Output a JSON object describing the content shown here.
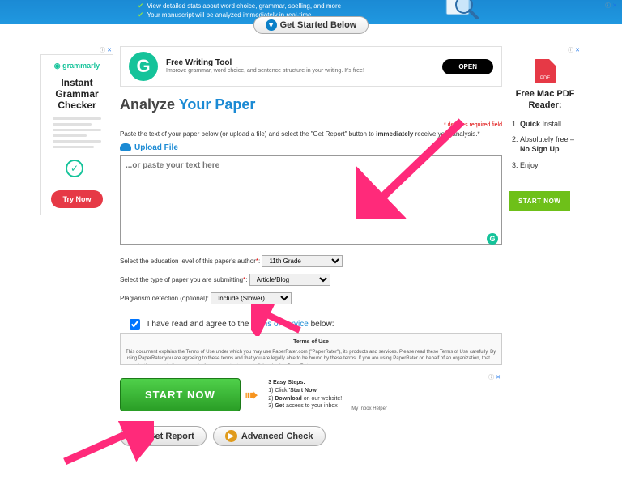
{
  "top_banner": {
    "line1": "View detailed stats about word choice, grammar, spelling, and more",
    "line2": "Your manuscript will be analyzed immediately in real-time"
  },
  "get_started": {
    "label": "Get Started Below"
  },
  "left_ad": {
    "brand": "grammarly",
    "title": "Instant Grammar Checker",
    "cta": "Try Now"
  },
  "inline_ad": {
    "title": "Free Writing Tool",
    "subtitle": "Improve grammar, word choice, and sentence structure in your writing. It's free!",
    "cta": "OPEN"
  },
  "analyze": {
    "word1": "Analyze",
    "word2": "Your Paper",
    "required_note": "* denotes required field",
    "instruction_pre": "Paste the text of your paper below (or upload a file) and select the \"Get Report\" button to ",
    "instruction_bold": "immediately",
    "instruction_post": " receive your analysis.*",
    "upload_label": "Upload File",
    "placeholder": "...or paste your text here"
  },
  "form": {
    "edu_label": "Select the education level of this paper's author",
    "edu_value": "11th Grade",
    "type_label": "Select the type of paper you are submitting",
    "type_value": "Article/Blog",
    "plag_label": "Plagiarism detection (optional):",
    "plag_value": "Include (Slower)"
  },
  "agree": {
    "pre": "I have read and agree to the ",
    "link": "terms of service",
    "post": " below:"
  },
  "tos": {
    "title": "Terms of Use",
    "body": "This document explains the Terms of Use under which you may use PaperRater.com (\"PaperRater\"), its products and services. Please read these Terms of Use carefully. By using PaperRater you are agreeing to these terms and that you are legally able to be bound by these terms. If you are using PaperRater on behalf of an organization, that organization accepts these terms to the same extent as an individual using PaperRater."
  },
  "bottom_ad": {
    "cta": "START NOW",
    "steps_title": "3 Easy Steps:",
    "step1_pre": "1) Click ",
    "step1_b": "'Start Now'",
    "step2_pre": "2) ",
    "step2_b": "Download",
    "step2_post": " on our website!",
    "step3_pre": "3) ",
    "step3_b": "Get",
    "step3_post": " access to your inbox",
    "helper": "My Inbox Helper"
  },
  "buttons": {
    "get_report": "Get Report",
    "advanced": "Advanced Check"
  },
  "right_ad": {
    "pdf_label": "PDF",
    "title": "Free Mac PDF Reader:",
    "li1_b": "Quick",
    "li1_post": " Install",
    "li2_pre": "Absolutely free – ",
    "li2_b": "No Sign Up",
    "li3": "Enjoy",
    "cta": "START NOW"
  }
}
